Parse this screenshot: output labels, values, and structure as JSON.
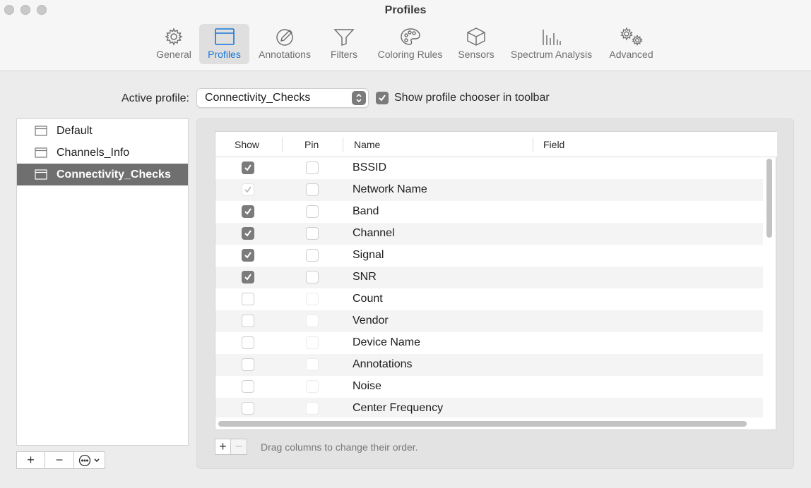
{
  "window": {
    "title": "Profiles"
  },
  "tabs": [
    {
      "label": "General",
      "icon": "gear-icon",
      "active": false
    },
    {
      "label": "Profiles",
      "icon": "window-icon",
      "active": true
    },
    {
      "label": "Annotations",
      "icon": "pencil-circle-icon",
      "active": false
    },
    {
      "label": "Filters",
      "icon": "funnel-icon",
      "active": false
    },
    {
      "label": "Coloring Rules",
      "icon": "palette-icon",
      "active": false
    },
    {
      "label": "Sensors",
      "icon": "cube-icon",
      "active": false
    },
    {
      "label": "Spectrum Analysis",
      "icon": "spectrum-bars-icon",
      "active": false
    },
    {
      "label": "Advanced",
      "icon": "gears-icon",
      "active": false
    }
  ],
  "active_profile": {
    "label": "Active profile:",
    "value": "Connectivity_Checks",
    "show_chooser_label": "Show profile chooser in toolbar",
    "show_chooser_checked": true
  },
  "profiles": {
    "items": [
      {
        "name": "Default",
        "selected": false
      },
      {
        "name": "Channels_Info",
        "selected": false
      },
      {
        "name": "Connectivity_Checks",
        "selected": true
      }
    ],
    "controls": {
      "add": "+",
      "remove": "−"
    }
  },
  "columns_table": {
    "headers": {
      "show": "Show",
      "pin": "Pin",
      "name": "Name",
      "field": "Field"
    },
    "rows": [
      {
        "name": "BSSID",
        "show": "checked",
        "pin": "unchecked"
      },
      {
        "name": "Network Name",
        "show": "checked-disabled",
        "pin": "unchecked"
      },
      {
        "name": "Band",
        "show": "checked",
        "pin": "unchecked"
      },
      {
        "name": "Channel",
        "show": "checked",
        "pin": "unchecked"
      },
      {
        "name": "Signal",
        "show": "checked",
        "pin": "unchecked"
      },
      {
        "name": "SNR",
        "show": "checked",
        "pin": "unchecked"
      },
      {
        "name": "Count",
        "show": "unchecked",
        "pin": "unchecked-disabled"
      },
      {
        "name": "Vendor",
        "show": "unchecked",
        "pin": "unchecked-disabled"
      },
      {
        "name": "Device Name",
        "show": "unchecked",
        "pin": "unchecked-disabled"
      },
      {
        "name": "Annotations",
        "show": "unchecked",
        "pin": "unchecked-disabled"
      },
      {
        "name": "Noise",
        "show": "unchecked",
        "pin": "unchecked-disabled"
      },
      {
        "name": "Center Frequency",
        "show": "unchecked",
        "pin": "unchecked-disabled"
      }
    ],
    "controls": {
      "add": "+",
      "remove": "−"
    },
    "hint": "Drag columns to change their order."
  },
  "colors": {
    "accent": "#1877d8",
    "checkbox_on": "#7b7b7b",
    "selection": "#6f6f6f"
  }
}
